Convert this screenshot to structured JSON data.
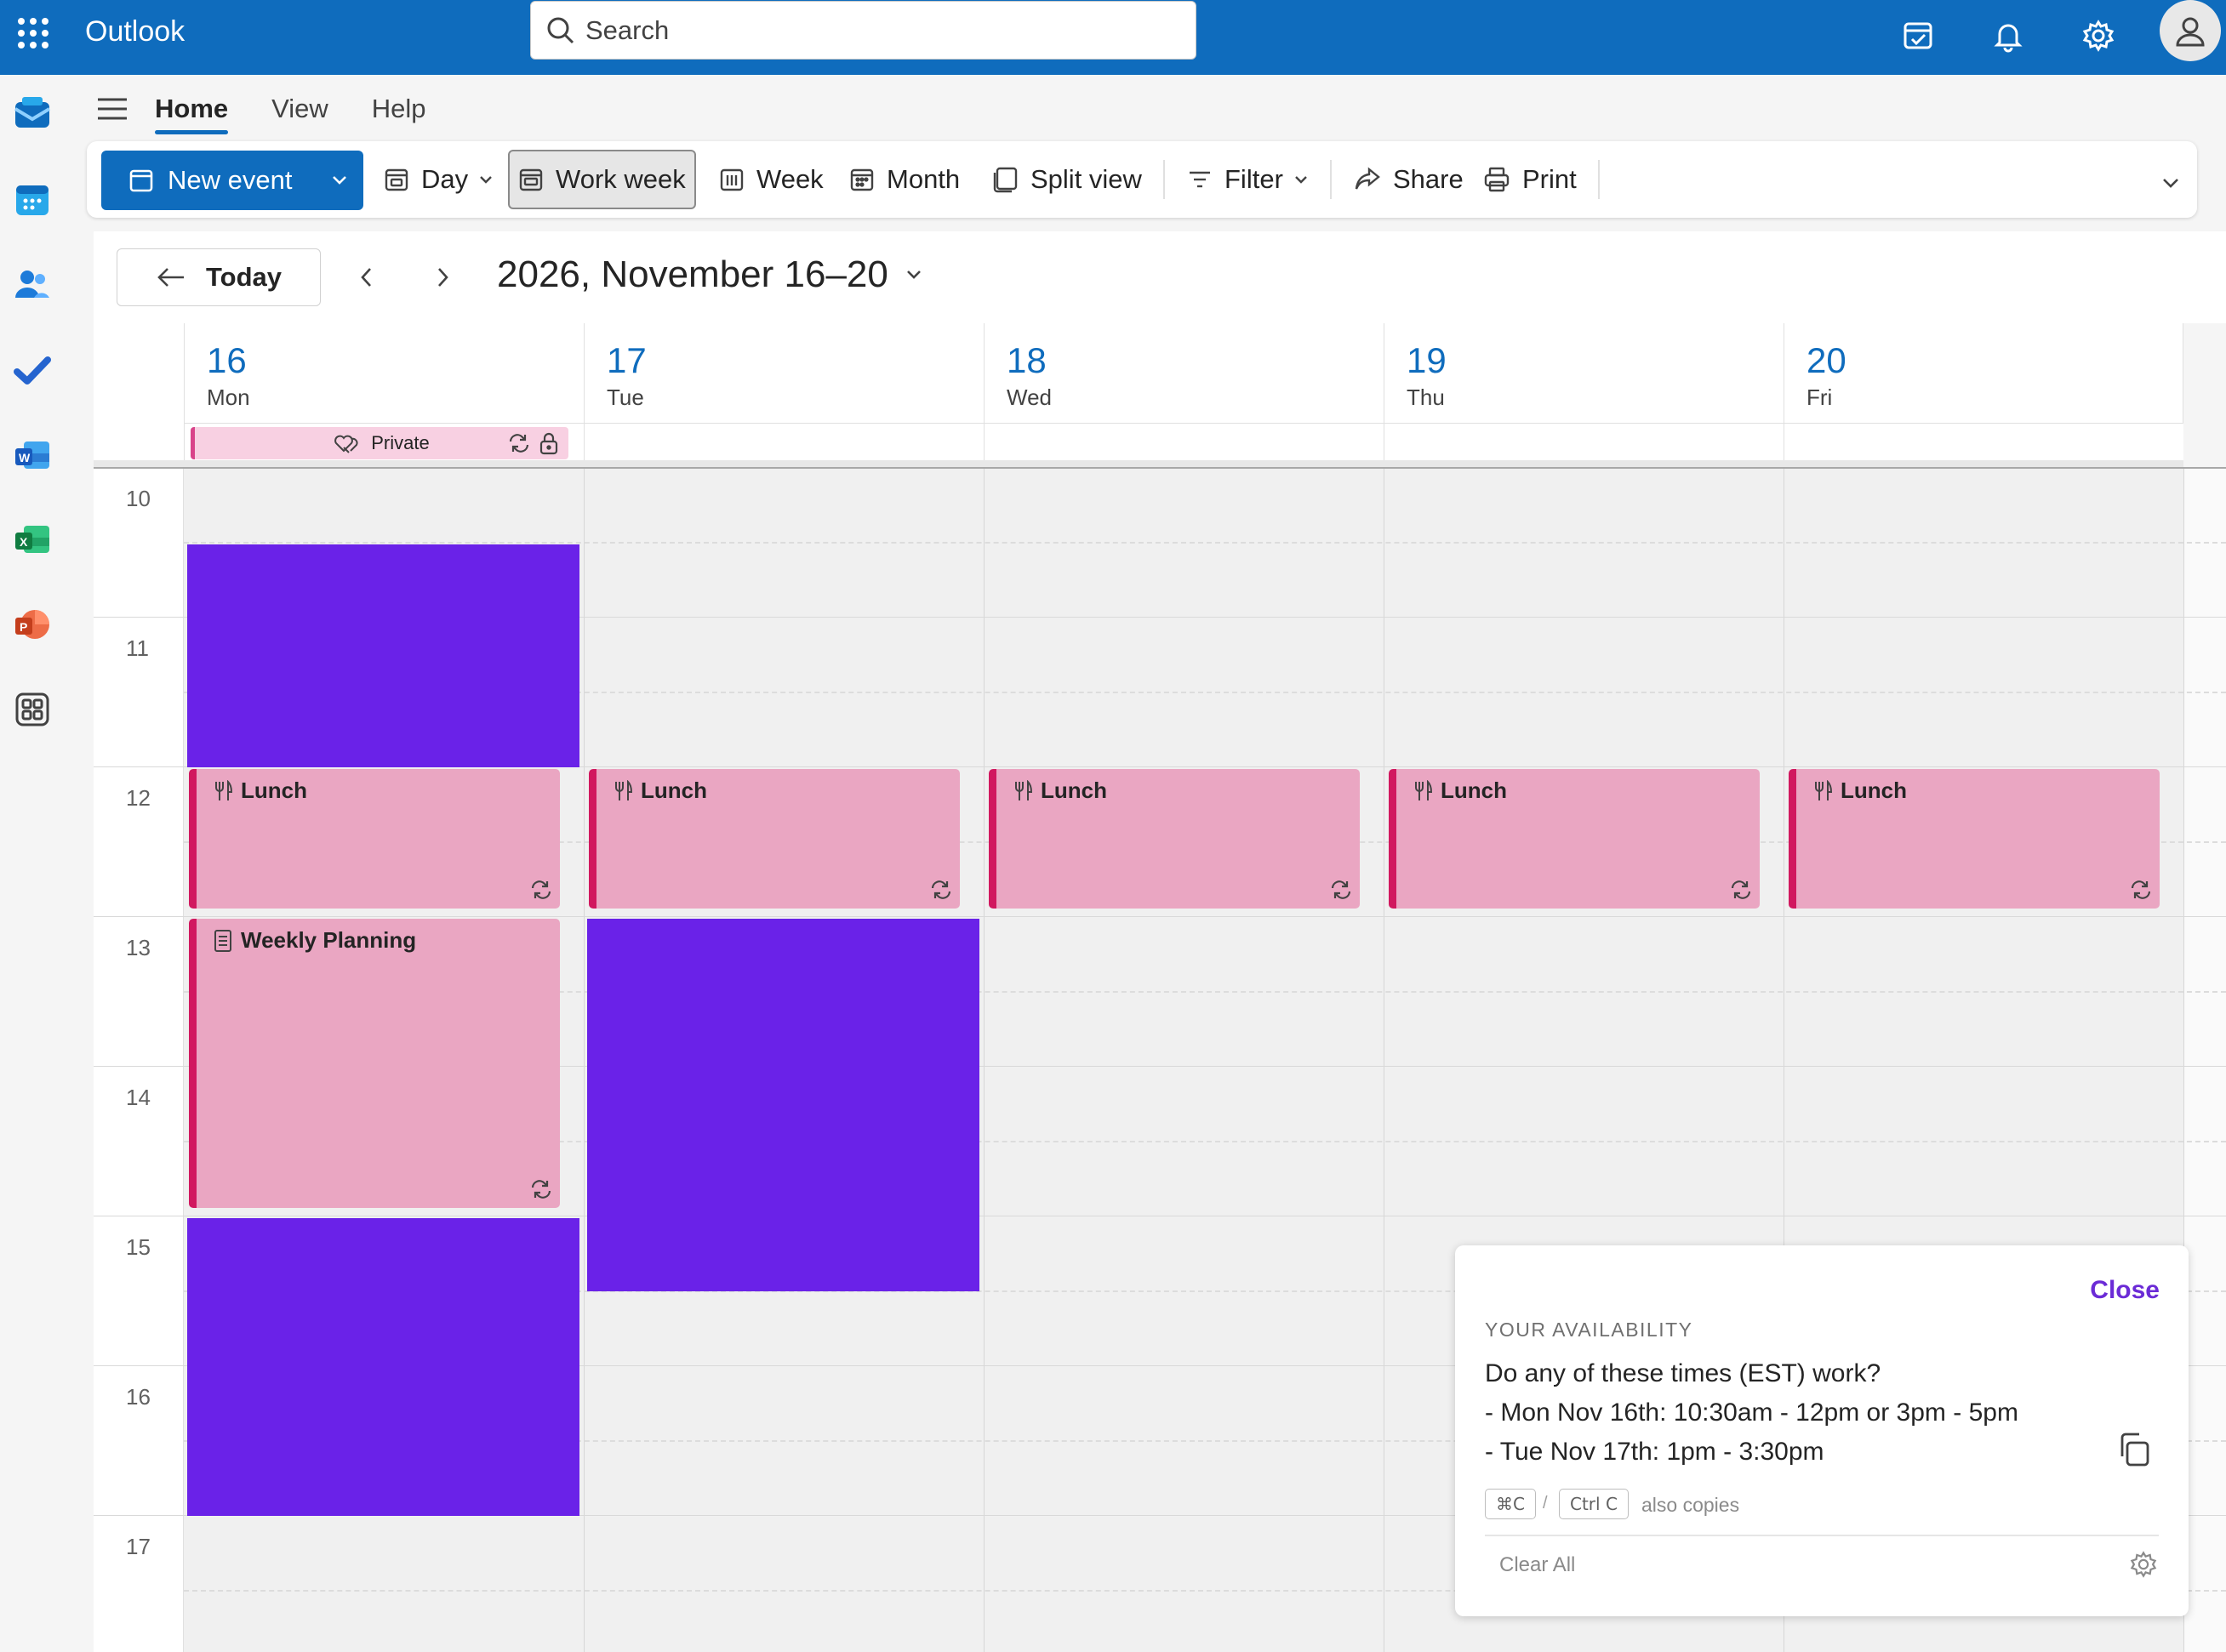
{
  "app": {
    "title": "Outlook"
  },
  "search": {
    "placeholder": "Search"
  },
  "nav_tabs": [
    {
      "label": "Home",
      "active": true
    },
    {
      "label": "View",
      "active": false
    },
    {
      "label": "Help",
      "active": false
    }
  ],
  "ribbon": {
    "new_event": "New event",
    "day": "Day",
    "work_week": "Work week",
    "week": "Week",
    "month": "Month",
    "split_view": "Split view",
    "filter": "Filter",
    "share": "Share",
    "print": "Print"
  },
  "calendar": {
    "today_label": "Today",
    "range_label": "2026, November 16–20",
    "days": [
      {
        "num": "16",
        "name": "Mon"
      },
      {
        "num": "17",
        "name": "Tue"
      },
      {
        "num": "18",
        "name": "Wed"
      },
      {
        "num": "19",
        "name": "Thu"
      },
      {
        "num": "20",
        "name": "Fri"
      }
    ],
    "hours": [
      "10",
      "11",
      "12",
      "13",
      "14",
      "15",
      "16",
      "17"
    ],
    "all_day_event": {
      "label": "Private"
    },
    "events": {
      "lunch": "Lunch",
      "weekly_planning": "Weekly Planning"
    }
  },
  "colors": {
    "brand": "#0f6cbd",
    "busy_block": "#6a22e8",
    "event_fill": "#eaa6c2",
    "event_border": "#d1185f",
    "close_link": "#6b2bd6"
  },
  "availability": {
    "close_label": "Close",
    "heading": "YOUR AVAILABILITY",
    "question": "Do any of these times (EST) work?",
    "line1": "- Mon Nov 16th: 10:30am - 12pm or 3pm - 5pm",
    "line2": "- Tue Nov 17th: 1pm - 3:30pm",
    "shortcut_mac": "⌘C",
    "shortcut_sep": "/",
    "shortcut_win": "Ctrl C",
    "also_copies": "also copies",
    "clear_all": "Clear All"
  }
}
